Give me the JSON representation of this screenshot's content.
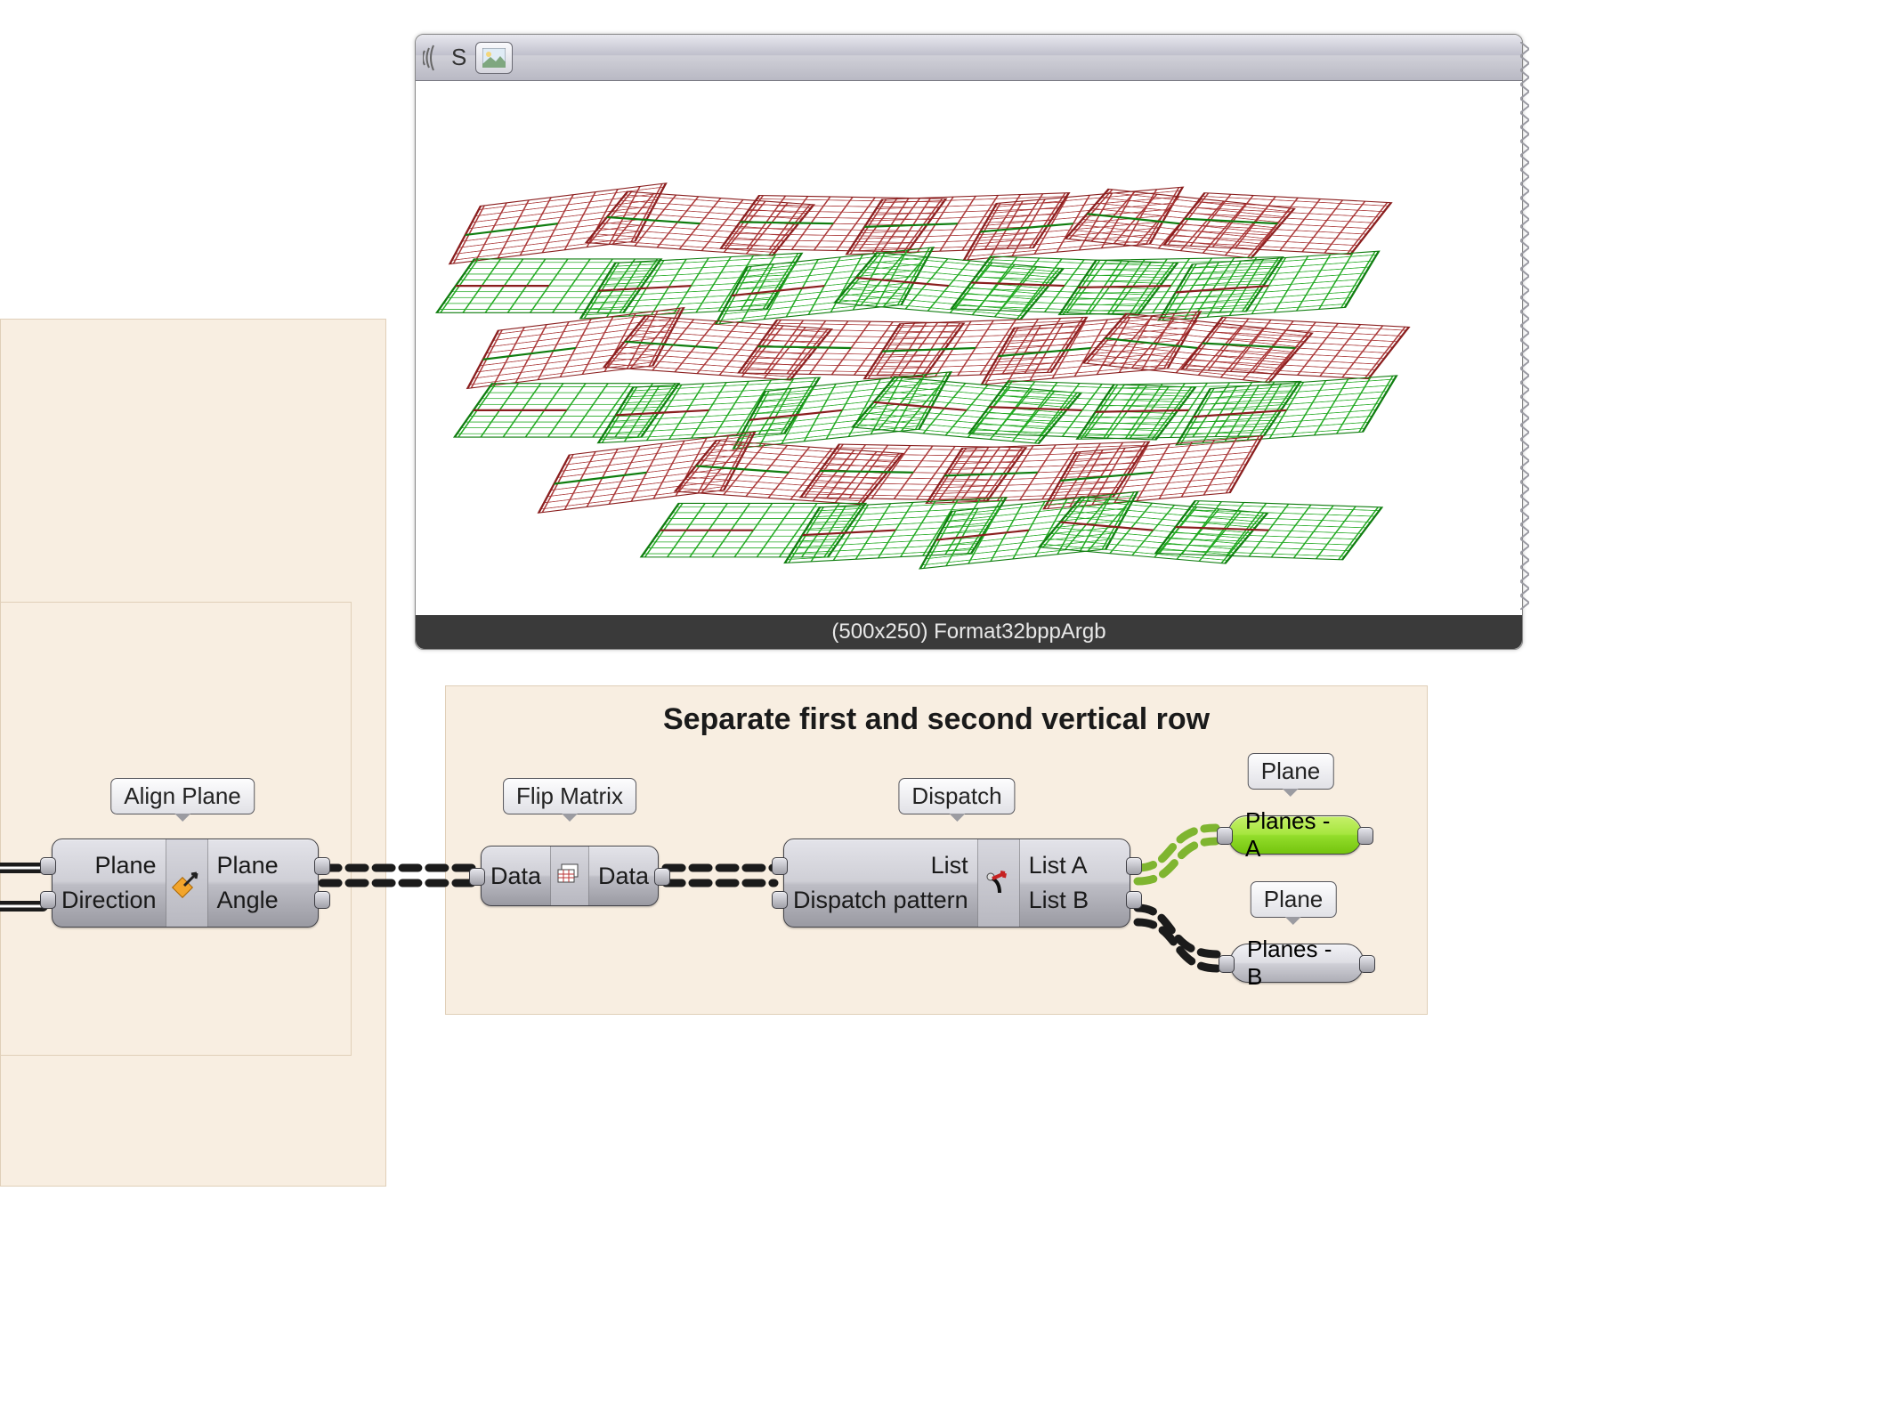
{
  "viewer": {
    "title_badge": "S",
    "status": "(500x250) Format32bppArgb"
  },
  "group3": {
    "title": "Separate first and second vertical row"
  },
  "labels": {
    "align_plane": "Align Plane",
    "flip_matrix": "Flip Matrix",
    "dispatch": "Dispatch",
    "plane_a": "Plane",
    "plane_b": "Plane"
  },
  "nodes": {
    "align_plane": {
      "in": [
        "Plane",
        "Direction"
      ],
      "out": [
        "Plane",
        "Angle"
      ]
    },
    "flip_matrix": {
      "in": [
        "Data"
      ],
      "out": [
        "Data"
      ]
    },
    "dispatch": {
      "in": [
        "List",
        "Dispatch pattern"
      ],
      "out": [
        "List A",
        "List B"
      ]
    }
  },
  "params": {
    "planes_a": "Planes - A",
    "planes_b": "Planes - B"
  }
}
